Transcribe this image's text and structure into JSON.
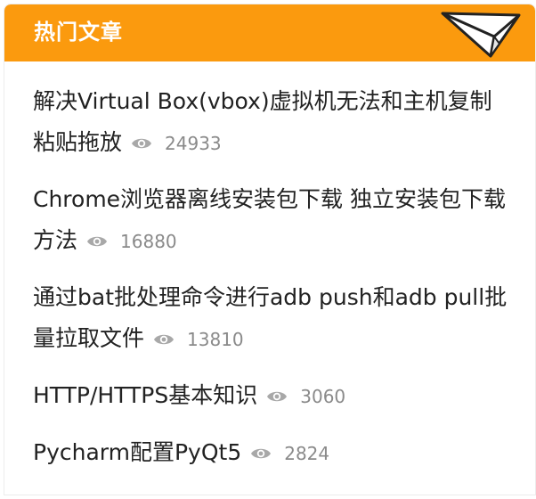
{
  "widget": {
    "title": "热门文章",
    "accent_color": "#fb9a0e",
    "header_icon": "paper-plane-icon",
    "view_icon": "eye-icon"
  },
  "articles": [
    {
      "title": "解决Virtual Box(vbox)虚拟机无法和主机复制粘贴拖放",
      "views": "24933"
    },
    {
      "title": "Chrome浏览器离线安装包下载 独立安装包下载 方法",
      "views": "16880"
    },
    {
      "title": "通过bat批处理命令进行adb push和adb pull批量拉取文件",
      "views": "13810"
    },
    {
      "title": "HTTP/HTTPS基本知识",
      "views": "3060"
    },
    {
      "title": "Pycharm配置PyQt5",
      "views": "2824"
    }
  ]
}
